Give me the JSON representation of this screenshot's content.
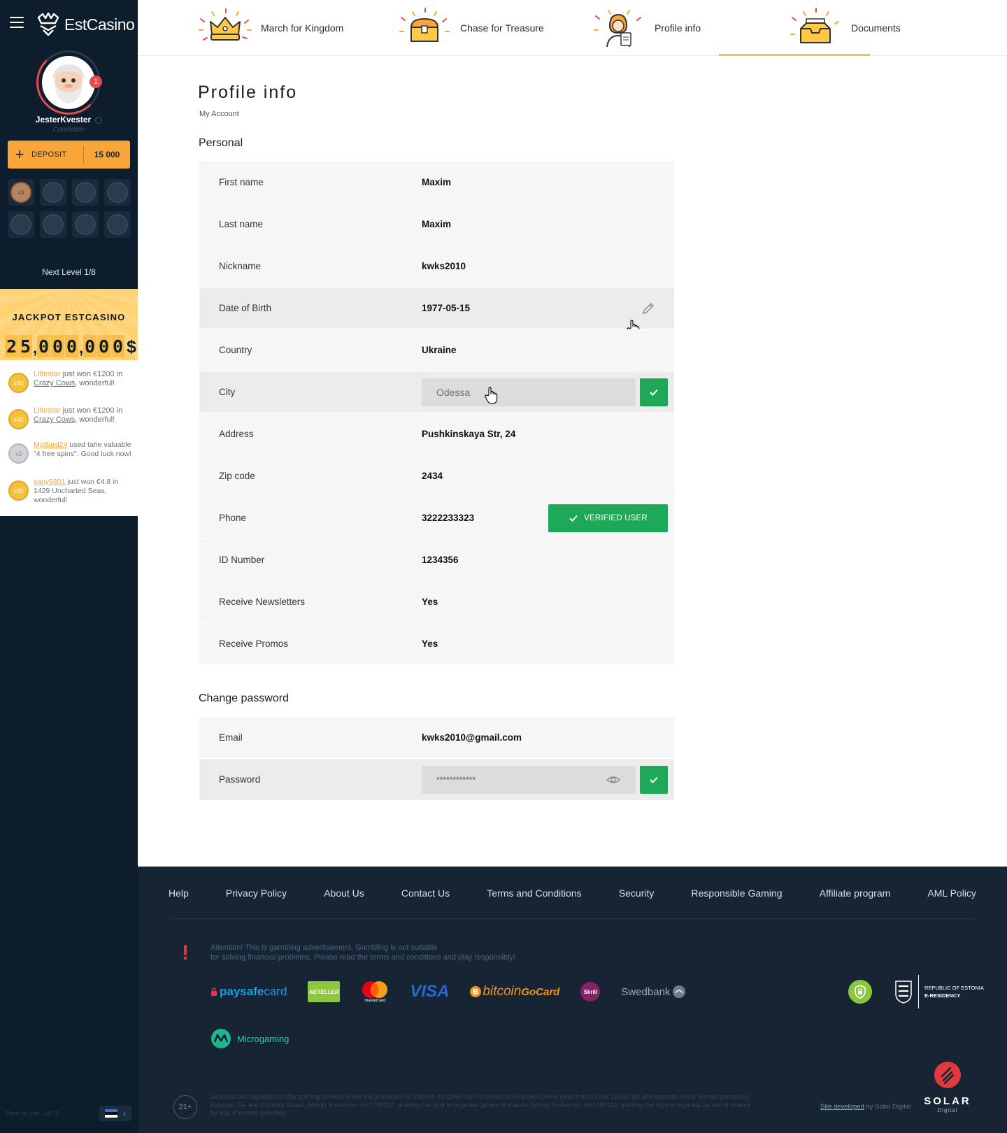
{
  "sidebar": {
    "brand": "EstCasino",
    "avatar_badge": "1",
    "username": "JesterKvester",
    "user_status": "Condidate",
    "deposit": {
      "label": "DEPOSIT",
      "amount": "15 000"
    },
    "level_coin_active": "x3",
    "next_level": "Next Level 1/8",
    "jackpot": {
      "title": "JACKPOT ESTCASINO",
      "digits": [
        "2",
        "5",
        "0",
        "0",
        "0",
        "0",
        "0",
        "0"
      ],
      "currency": "$"
    },
    "feed": [
      {
        "coin": "x40",
        "coin_type": "gold",
        "user": "Litlestar",
        "middle": " just won €1200 in ",
        "game": "Crazy Cows",
        "end": ", wonderful!"
      },
      {
        "coin": "x40",
        "coin_type": "gold",
        "user": "Litlestar",
        "middle": " just won €1200 in ",
        "game": "Crazy Cows",
        "end": ", wonderful!"
      },
      {
        "coin": "x3",
        "coin_type": "silver",
        "user": "Mgillard24",
        "middle": " used tahe valuable \"4 free spins\". Good luck now!",
        "game": "",
        "end": ""
      },
      {
        "coin": "x40",
        "coin_type": "gold",
        "user": "vany5801",
        "middle": " just won €4.8 in 1429 Uncharted Seas, wonderful!",
        "game": "",
        "end": ""
      }
    ],
    "time_on_site": "Time on site: 14:59"
  },
  "tabs": [
    {
      "label": "March for Kingdom",
      "icon": "crown-icon"
    },
    {
      "label": "Chase for Treasure",
      "icon": "treasure-chest-icon"
    },
    {
      "label": "Profile info",
      "icon": "profile-avatar-icon",
      "active": true
    },
    {
      "label": "Documents",
      "icon": "document-box-icon"
    }
  ],
  "page": {
    "title": "Profile info",
    "breadcrumb": "My Account",
    "personal_title": "Personal",
    "password_title": "Change password"
  },
  "personal": {
    "first_name": {
      "label": "First name",
      "value": "Maxim"
    },
    "last_name": {
      "label": "Last name",
      "value": "Maxim"
    },
    "nickname": {
      "label": "Nickname",
      "value": "kwks2010"
    },
    "dob": {
      "label": "Date of Birth",
      "value": "1977-05-15"
    },
    "country": {
      "label": "Country",
      "value": "Ukraine"
    },
    "city": {
      "label": "City",
      "value": "Odessa"
    },
    "address": {
      "label": "Address",
      "value": "Pushkinskaya Str, 24"
    },
    "zip": {
      "label": "Zip code",
      "value": "2434"
    },
    "phone": {
      "label": "Phone",
      "value": "3222233323",
      "badge": "VERIFIED USER"
    },
    "id_number": {
      "label": "ID Number",
      "value": "1234356"
    },
    "newsletters": {
      "label": "Receive Newsletters",
      "value": "Yes"
    },
    "promos": {
      "label": "Receive Promos",
      "value": "Yes"
    }
  },
  "account": {
    "email": {
      "label": "Email",
      "value": "kwks2010@gmail.com"
    },
    "password": {
      "label": "Password",
      "value": "************"
    }
  },
  "footer": {
    "links": [
      "Help",
      "Privacy Policy",
      "About Us",
      "Contact Us",
      "Terms and Conditions",
      "Security",
      "Responsible Gaming",
      "Affiliate program",
      "AML Policy"
    ],
    "attention_mark": "!",
    "attention_line1": "Attention! This is gambling advertisement. Gambling is not suitable",
    "attention_line2": "for solving financial problems. Please read the terms and conditions and play responsibly!",
    "payments": {
      "paysafe_a": "paysafe",
      "paysafe_b": "card",
      "neteller": "NETELLER",
      "mastercard": "mastercard",
      "visa": "VISA",
      "bitcoin": "bitcoin",
      "gocard": "GoCard",
      "skrill": "Skrill",
      "swedbank": "Swedbank",
      "microgaming": "Microgaming"
    },
    "estonia_line1": "Republic of Estonia",
    "estonia_line2": "E-Residency",
    "age": "21+",
    "license": "Licensed and regulated to offer gaming services under the jurisdiction of Estonia. Kingswin.com is owned by Kingswin Online (registration code 11535738) and operates under license granted by Estonian Tax and Customs Board. Activity licence no. HKT000017, granting the right to organise games of chance. Activity licence no. HKL000126, granting the right to organise games of chance by way of remote gambling.",
    "site_developed": "Site developed",
    "by": " by Solar Digital",
    "solar": "SOLAR",
    "solar_sub": "Digital"
  },
  "colors": {
    "sidebar_bg": "#0d1d2c",
    "accent": "#f8a63a",
    "success": "#1ea95a",
    "footer_bg": "#172433"
  }
}
